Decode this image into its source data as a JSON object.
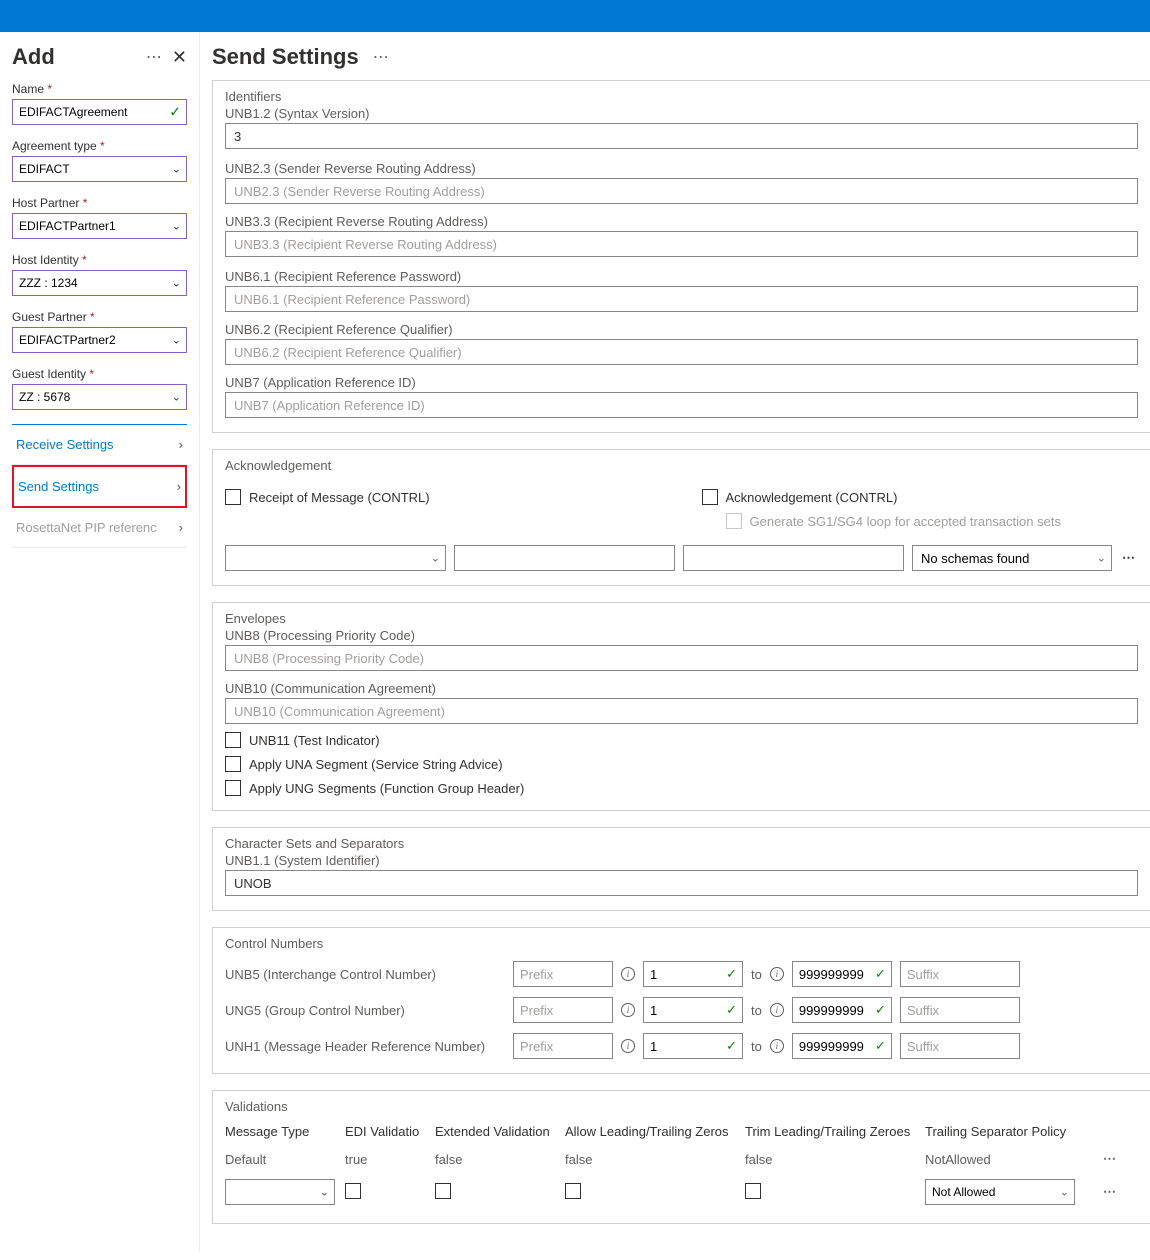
{
  "sidebar": {
    "title": "Add",
    "fields": {
      "name": {
        "label": "Name",
        "value": "EDIFACTAgreement"
      },
      "agreement_type": {
        "label": "Agreement type",
        "value": "EDIFACT"
      },
      "host_partner": {
        "label": "Host Partner",
        "value": "EDIFACTPartner1"
      },
      "host_identity": {
        "label": "Host Identity",
        "value": "ZZZ : 1234"
      },
      "guest_partner": {
        "label": "Guest Partner",
        "value": "EDIFACTPartner2"
      },
      "guest_identity": {
        "label": "Guest Identity",
        "value": "ZZ : 5678"
      }
    },
    "nav": {
      "receive": "Receive Settings",
      "send": "Send Settings",
      "rosetta": "RosettaNet PIP referenc"
    }
  },
  "main": {
    "title": "Send Settings",
    "identifiers": {
      "title": "Identifiers",
      "unb12": {
        "label": "UNB1.2 (Syntax Version)",
        "value": "3"
      },
      "unb23": {
        "label": "UNB2.3 (Sender Reverse Routing Address)",
        "placeholder": "UNB2.3 (Sender Reverse Routing Address)"
      },
      "unb33": {
        "label": "UNB3.3 (Recipient Reverse Routing Address)",
        "placeholder": "UNB3.3 (Recipient Reverse Routing Address)"
      },
      "unb61": {
        "label": "UNB6.1 (Recipient Reference Password)",
        "placeholder": "UNB6.1 (Recipient Reference Password)"
      },
      "unb62": {
        "label": "UNB6.2 (Recipient Reference Qualifier)",
        "placeholder": "UNB6.2 (Recipient Reference Qualifier)"
      },
      "unb7": {
        "label": "UNB7 (Application Reference ID)",
        "placeholder": "UNB7 (Application Reference ID)"
      }
    },
    "ack": {
      "title": "Acknowledgement",
      "receipt": "Receipt of Message (CONTRL)",
      "ack_contrl": "Acknowledgement (CONTRL)",
      "generate": "Generate SG1/SG4 loop for accepted transaction sets",
      "no_schemas": "No schemas found"
    },
    "envelopes": {
      "title": "Envelopes",
      "unb8": {
        "label": "UNB8 (Processing Priority Code)",
        "placeholder": "UNB8 (Processing Priority Code)"
      },
      "unb10": {
        "label": "UNB10 (Communication Agreement)",
        "placeholder": "UNB10 (Communication Agreement)"
      },
      "unb11": "UNB11 (Test Indicator)",
      "apply_una": "Apply UNA Segment (Service String Advice)",
      "apply_ung": "Apply UNG Segments (Function Group Header)"
    },
    "charsets": {
      "title": "Character Sets and Separators",
      "unb11": {
        "label": "UNB1.1 (System Identifier)",
        "value": "UNOB"
      }
    },
    "control": {
      "title": "Control Numbers",
      "prefix_ph": "Prefix",
      "suffix_ph": "Suffix",
      "to": "to",
      "rows": [
        {
          "label": "UNB5 (Interchange Control Number)",
          "from": "1",
          "to": "999999999"
        },
        {
          "label": "UNG5 (Group Control Number)",
          "from": "1",
          "to": "999999999"
        },
        {
          "label": "UNH1 (Message Header Reference Number)",
          "from": "1",
          "to": "999999999"
        }
      ]
    },
    "validations": {
      "title": "Validations",
      "headers": {
        "msg": "Message Type",
        "edi": "EDI Validatio",
        "ext": "Extended Validation",
        "lead": "Allow Leading/Trailing Zeros",
        "trim": "Trim Leading/Trailing Zeroes",
        "trail": "Trailing Separator Policy"
      },
      "default_row": {
        "msg": "Default",
        "edi": "true",
        "ext": "false",
        "lead": "false",
        "trim": "false",
        "trail": "NotAllowed"
      },
      "policy_value": "Not Allowed"
    }
  }
}
